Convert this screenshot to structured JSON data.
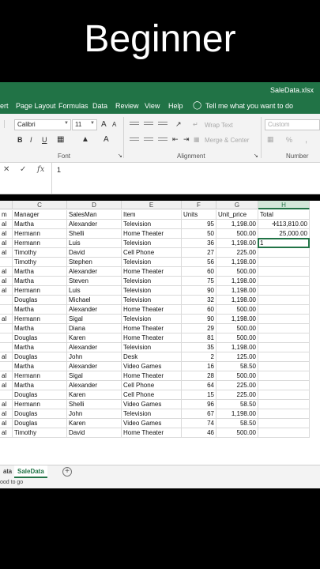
{
  "banner": {
    "title": "Beginner"
  },
  "titlebar": {
    "filename": "SaleData.xlsx"
  },
  "menu": {
    "items": [
      "ert",
      "Page Layout",
      "Formulas",
      "Data",
      "Review",
      "View",
      "Help"
    ],
    "tell_me": "Tell me what you want to do"
  },
  "ribbon": {
    "font_name": "Calibri",
    "font_size": "11",
    "bold": "B",
    "italic": "I",
    "underline": "U",
    "font_color": "A",
    "grow_font": "A",
    "shrink_font": "A",
    "wrap_text": "Wrap Text",
    "merge_center": "Merge & Center",
    "number_format": "Custom",
    "percent": "%",
    "comma": ",",
    "font_group": "Font",
    "alignment_group": "Alignment",
    "number_group": "Number"
  },
  "formula_bar": {
    "cancel": "✕",
    "enter": "✓",
    "fx": "fx",
    "content": "1"
  },
  "columns": [
    {
      "letter": "",
      "header": "m",
      "active": false
    },
    {
      "letter": "C",
      "header": "Manager",
      "active": false
    },
    {
      "letter": "D",
      "header": "SalesMan",
      "active": false
    },
    {
      "letter": "E",
      "header": "Item",
      "active": false
    },
    {
      "letter": "F",
      "header": "Units",
      "active": false
    },
    {
      "letter": "G",
      "header": "Unit_price",
      "active": false
    },
    {
      "letter": "H",
      "header": "Total",
      "active": true
    }
  ],
  "rows": [
    [
      "al",
      "Martha",
      "Alexander",
      "Television",
      "95",
      "1,198.00",
      "113,810.00"
    ],
    [
      "al",
      "Hermann",
      "Shelli",
      "Home Theater",
      "50",
      "500.00",
      "25,000.00"
    ],
    [
      "al",
      "Hermann",
      "Luis",
      "Television",
      "36",
      "1,198.00",
      "1"
    ],
    [
      "al",
      "Timothy",
      "David",
      "Cell Phone",
      "27",
      "225.00",
      ""
    ],
    [
      "",
      "Timothy",
      "Stephen",
      "Television",
      "56",
      "1,198.00",
      ""
    ],
    [
      "al",
      "Martha",
      "Alexander",
      "Home Theater",
      "60",
      "500.00",
      ""
    ],
    [
      "al",
      "Martha",
      "Steven",
      "Television",
      "75",
      "1,198.00",
      ""
    ],
    [
      "al",
      "Hermann",
      "Luis",
      "Television",
      "90",
      "1,198.00",
      ""
    ],
    [
      "",
      "Douglas",
      "Michael",
      "Television",
      "32",
      "1,198.00",
      ""
    ],
    [
      "",
      "Martha",
      "Alexander",
      "Home Theater",
      "60",
      "500.00",
      ""
    ],
    [
      "al",
      "Hermann",
      "Sigal",
      "Television",
      "90",
      "1,198.00",
      ""
    ],
    [
      "",
      "Martha",
      "Diana",
      "Home Theater",
      "29",
      "500.00",
      ""
    ],
    [
      "",
      "Douglas",
      "Karen",
      "Home Theater",
      "81",
      "500.00",
      ""
    ],
    [
      "",
      "Martha",
      "Alexander",
      "Television",
      "35",
      "1,198.00",
      ""
    ],
    [
      "al",
      "Douglas",
      "John",
      "Desk",
      "2",
      "125.00",
      ""
    ],
    [
      "",
      "Martha",
      "Alexander",
      "Video Games",
      "16",
      "58.50",
      ""
    ],
    [
      "al",
      "Hermann",
      "Sigal",
      "Home Theater",
      "28",
      "500.00",
      ""
    ],
    [
      "al",
      "Martha",
      "Alexander",
      "Cell Phone",
      "64",
      "225.00",
      ""
    ],
    [
      "",
      "Douglas",
      "Karen",
      "Cell Phone",
      "15",
      "225.00",
      ""
    ],
    [
      "al",
      "Hermann",
      "Shelli",
      "Video Games",
      "96",
      "58.50",
      ""
    ],
    [
      "al",
      "Douglas",
      "John",
      "Television",
      "67",
      "1,198.00",
      ""
    ],
    [
      "al",
      "Douglas",
      "Karen",
      "Video Games",
      "74",
      "58.50",
      ""
    ],
    [
      "al",
      "Timothy",
      "David",
      "Home Theater",
      "46",
      "500.00",
      ""
    ]
  ],
  "sheets": {
    "prev": "ata",
    "active": "SaleData",
    "add": "+"
  },
  "status": {
    "text": "ood to go"
  },
  "colors": {
    "excel_green": "#217346"
  }
}
